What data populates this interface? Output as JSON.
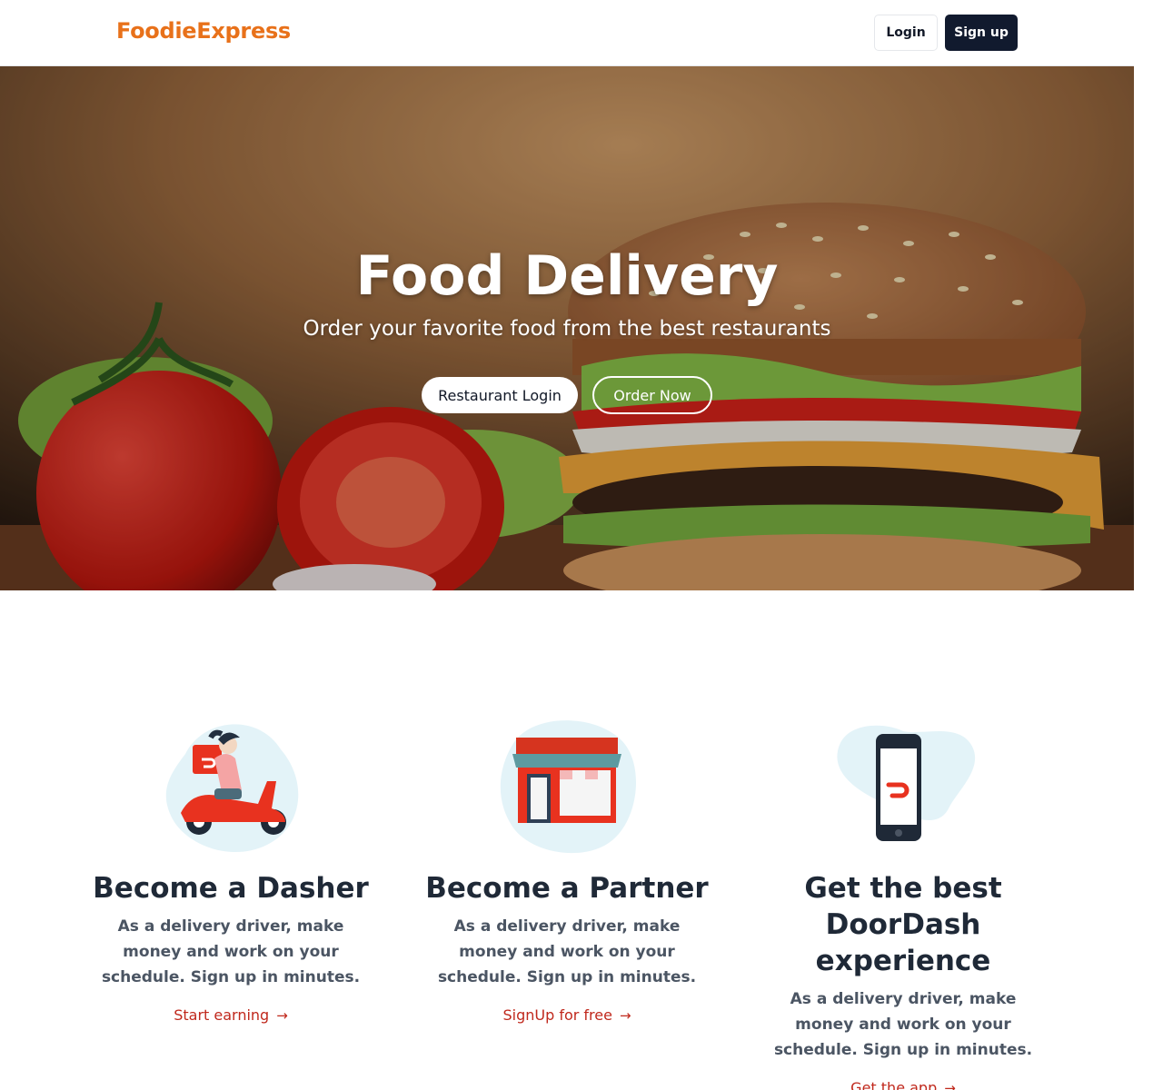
{
  "header": {
    "brand": "FoodieExpress",
    "login_label": "Login",
    "signup_label": "Sign up",
    "brand_color": "#e8711a"
  },
  "hero": {
    "title": "Food Delivery",
    "subtitle": "Order your favorite food from the best restaurants",
    "restaurant_login_label": "Restaurant Login",
    "order_now_label": "Order Now"
  },
  "features": [
    {
      "title": "Become a Dasher",
      "description": "As a delivery driver, make money and work on your schedule. Sign up in minutes.",
      "link": "Start earning",
      "icon": "scooter-courier-icon"
    },
    {
      "title": "Become a Partner",
      "description": "As a delivery driver, make money and work on your schedule. Sign up in minutes.",
      "link": "SignUp for free",
      "icon": "storefront-icon"
    },
    {
      "title": "Get the best DoorDash experience",
      "description": "As a delivery driver, make money and work on your schedule. Sign up in minutes.",
      "link": "Get the app",
      "icon": "phone-app-icon"
    }
  ],
  "colors": {
    "accent_link": "#c0281c",
    "dark_button": "#111a2e"
  }
}
